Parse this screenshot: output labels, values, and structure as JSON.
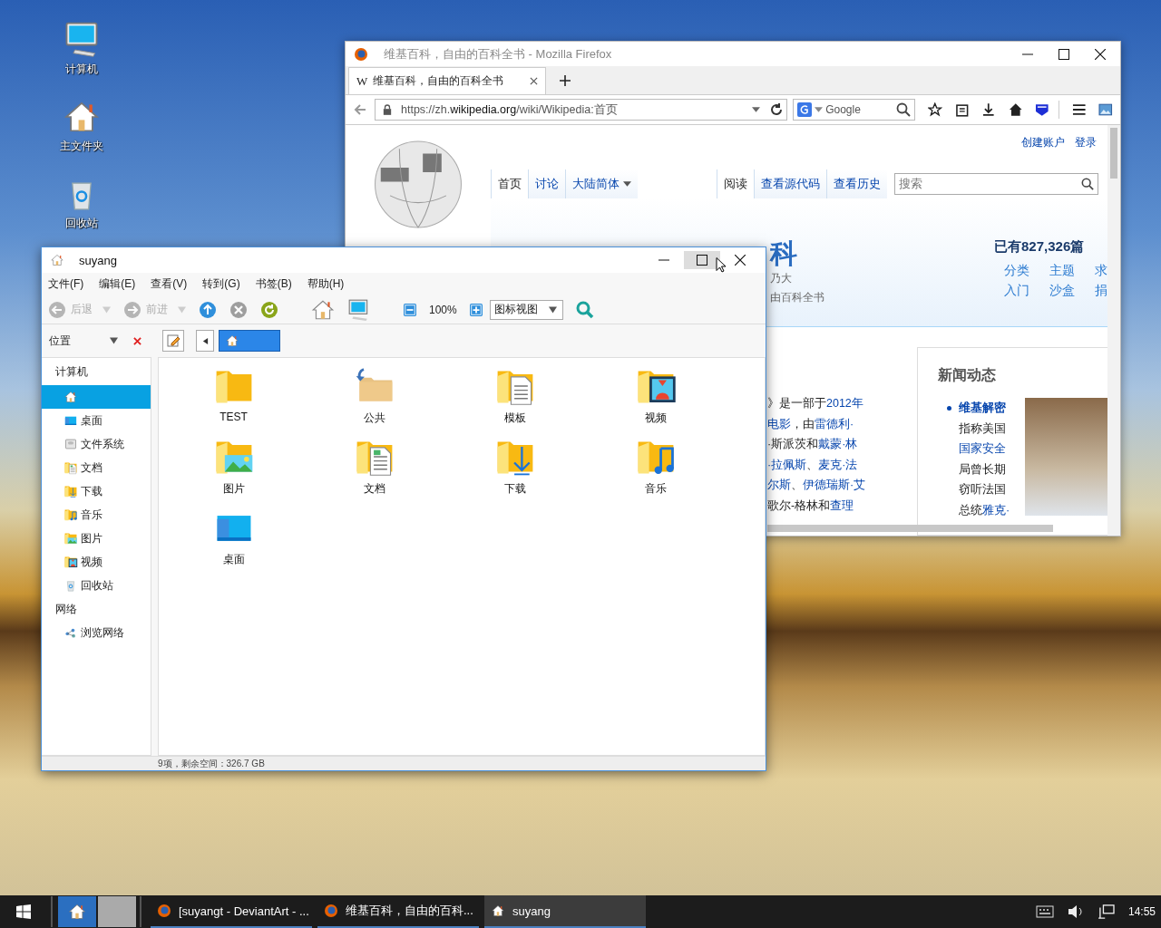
{
  "desktop": {
    "icons": [
      {
        "kind": "computer",
        "label": "计算机"
      },
      {
        "kind": "home",
        "label": "主文件夹"
      },
      {
        "kind": "trash",
        "label": "回收站"
      }
    ]
  },
  "firefox": {
    "title": "维基百科，自由的百科全书 - Mozilla Firefox",
    "tabs": [
      {
        "favicon": "W",
        "label": "维基百科，自由的百科全书",
        "selected": true
      }
    ],
    "url": "https://zh.**wikipedia.org**/wiki/Wikipedia:首页",
    "search": {
      "placeholder": "Google"
    },
    "page": {
      "personal_links": [
        "创建账户",
        "登录"
      ],
      "left_tabs": [
        {
          "label": "首页",
          "selected": true,
          "dropdown": false
        },
        {
          "label": "讨论",
          "selected": false,
          "dropdown": false
        },
        {
          "label": "大陆简体",
          "selected": false,
          "dropdown": true
        }
      ],
      "right_tabs": [
        {
          "label": "阅读",
          "selected": true
        },
        {
          "label": "查看源代码",
          "selected": false
        },
        {
          "label": "查看历史",
          "selected": false
        }
      ],
      "search": {
        "placeholder": "搜索"
      },
      "banner": {
        "title": "科",
        "lines": [
          "乃大",
          "由百科全书"
        ],
        "count": "已有827,326篇",
        "links": [
          "分类",
          "主题",
          "求",
          "入门",
          "沙盒",
          "捐"
        ]
      },
      "article_lines": [
        [
          {
            "text": "》是一部于",
            "link": false
          },
          {
            "text": "2012年",
            "link": true
          }
        ],
        [
          {
            "text": "电影",
            "link": true
          },
          {
            "text": "，由",
            "link": false
          },
          {
            "text": "雷德利·",
            "link": true
          }
        ],
        [
          {
            "text": "·斯派茨和",
            "link": false
          },
          {
            "text": "戴蒙·林",
            "link": true
          }
        ],
        [
          {
            "text": "·拉佩斯",
            "link": true
          },
          {
            "text": "、",
            "link": false
          },
          {
            "text": "麦克·法",
            "link": true
          }
        ],
        [
          {
            "text": "尔斯",
            "link": true
          },
          {
            "text": "、",
            "link": false
          },
          {
            "text": "伊德瑞斯·艾",
            "link": true
          }
        ],
        [
          {
            "text": "歌尔-格林和",
            "link": false
          },
          {
            "text": "查理",
            "link": true
          }
        ]
      ],
      "news": {
        "title": "新闻动态",
        "lines": [
          [
            {
              "text": "维基解密",
              "link": true
            }
          ],
          [
            {
              "text": "指称美国",
              "link": false
            }
          ],
          [
            {
              "text": "国家安全",
              "link": true
            }
          ],
          [
            {
              "text": "局曾长期",
              "link": false
            }
          ],
          [
            {
              "text": "窃听法国",
              "link": false
            }
          ],
          [
            {
              "text": "总统",
              "link": false
            },
            {
              "text": "雅克·",
              "link": true
            }
          ]
        ]
      }
    }
  },
  "file_manager": {
    "title": "suyang",
    "menu": [
      "文件(F)",
      "编辑(E)",
      "查看(V)",
      "转到(G)",
      "书签(B)",
      "帮助(H)"
    ],
    "toolbar": [
      {
        "kind": "back",
        "label": "后退",
        "disabled": true
      },
      {
        "kind": "forward",
        "label": "前进",
        "disabled": true
      },
      {
        "kind": "up",
        "disabled": false
      },
      {
        "kind": "stop",
        "disabled": true
      },
      {
        "kind": "reload",
        "disabled": false
      },
      {
        "kind": "home",
        "disabled": false
      },
      {
        "kind": "computer",
        "disabled": false
      },
      {
        "kind": "zoom-out",
        "disabled": false
      },
      {
        "kind": "zoom-level",
        "label": "100%",
        "disabled": false
      },
      {
        "kind": "zoom-in",
        "disabled": false
      },
      {
        "kind": "view",
        "label": "图标视图",
        "disabled": false
      },
      {
        "kind": "search",
        "disabled": false
      }
    ],
    "location_label": "位置",
    "sidebar": [
      {
        "label": "计算机",
        "items": [
          {
            "kind": "home",
            "selected": true
          },
          {
            "kind": "desktop",
            "label": "桌面",
            "selected": false
          },
          {
            "kind": "drive",
            "label": "文件系统",
            "selected": false
          },
          {
            "kind": "documents",
            "label": "文档",
            "selected": false
          },
          {
            "kind": "downloads",
            "label": "下载",
            "selected": false
          },
          {
            "kind": "music",
            "label": "音乐",
            "selected": false
          },
          {
            "kind": "pictures",
            "label": "图片",
            "selected": false
          },
          {
            "kind": "videos",
            "label": "视频",
            "selected": false
          },
          {
            "kind": "trash",
            "label": "回收站",
            "selected": false
          }
        ]
      },
      {
        "label": "网络",
        "items": [
          {
            "kind": "network",
            "label": "浏览网络",
            "selected": false
          }
        ]
      }
    ],
    "files": [
      {
        "kind": "folder",
        "label": "TEST"
      },
      {
        "kind": "public",
        "label": "公共"
      },
      {
        "kind": "templates",
        "label": "模板"
      },
      {
        "kind": "videos",
        "label": "视频"
      },
      {
        "kind": "pictures",
        "label": "图片"
      },
      {
        "kind": "documents",
        "label": "文档"
      },
      {
        "kind": "downloads",
        "label": "下载"
      },
      {
        "kind": "music",
        "label": "音乐"
      },
      {
        "kind": "desktop",
        "label": "桌面"
      }
    ],
    "status": "9项，剩余空间：326.7 GB"
  },
  "taskbar": {
    "tasks": [
      {
        "kind": "firefox",
        "label": "[suyangt - DeviantArt - ...",
        "selected": false
      },
      {
        "kind": "firefox",
        "label": "维基百科，自由的百科...",
        "selected": false
      },
      {
        "kind": "home",
        "label": "suyang",
        "selected": true
      }
    ],
    "clock": "14:55"
  }
}
